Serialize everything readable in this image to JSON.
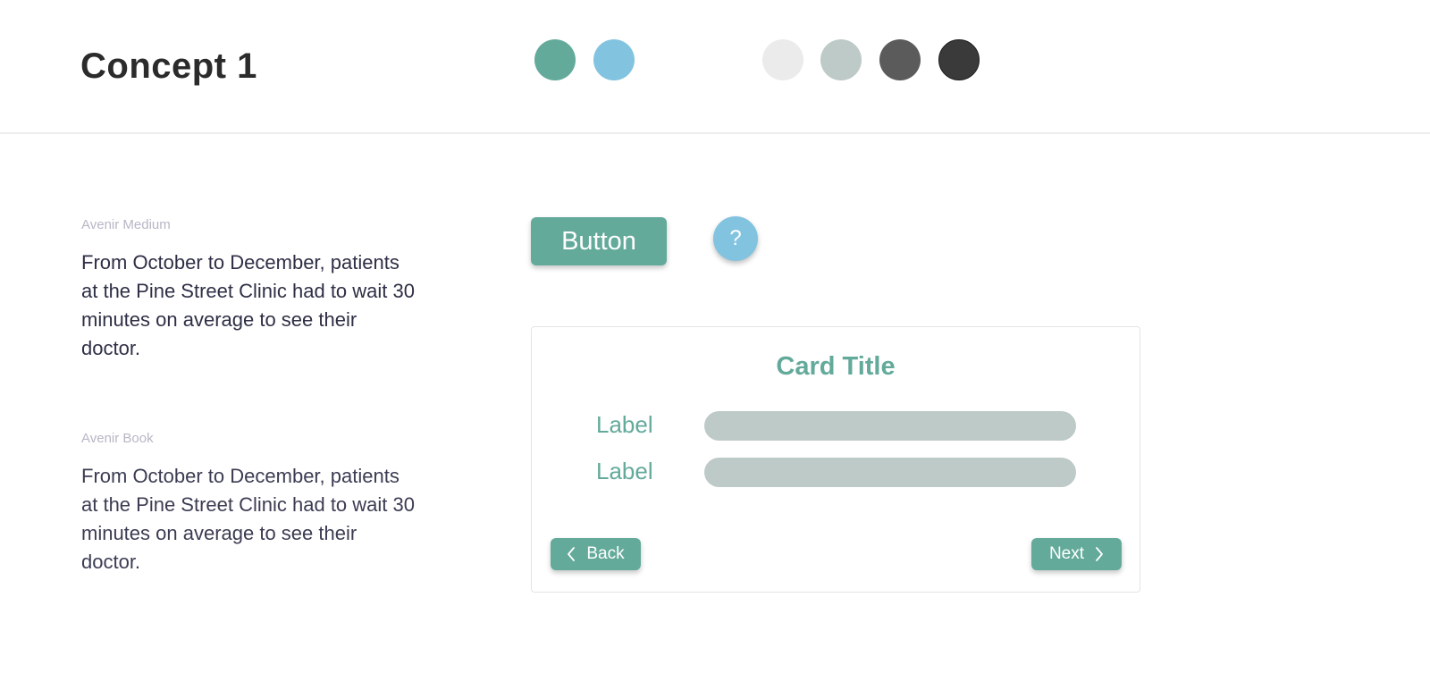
{
  "header": {
    "title": "Concept 1",
    "palette": [
      {
        "name": "teal",
        "color": "#63aa9b"
      },
      {
        "name": "sky-blue",
        "color": "#82c3e0"
      },
      {
        "name": "light-gray",
        "color": "#ebebeb"
      },
      {
        "name": "sage-gray",
        "color": "#bdcac7"
      },
      {
        "name": "dark-gray",
        "color": "#5b5b5b"
      },
      {
        "name": "charcoal",
        "color": "#3a3a3a"
      }
    ]
  },
  "typography": {
    "medium": {
      "label": "Avenir Medium",
      "sample": "From October to December, patients at the Pine Street Clinic had to wait 30 minutes on average to see their doctor."
    },
    "book": {
      "label": "Avenir Book",
      "sample": "From October to December, patients at the Pine Street Clinic had to wait 30 minutes on average to see their doctor."
    }
  },
  "components": {
    "button_label": "Button",
    "help_label": "?",
    "card": {
      "title": "Card Title",
      "fields": [
        {
          "label": "Label"
        },
        {
          "label": "Label"
        }
      ],
      "back_label": "Back",
      "next_label": "Next",
      "back_icon": "chevron-left-icon",
      "next_icon": "chevron-right-icon"
    }
  },
  "colors": {
    "accent": "#63aa9b",
    "secondary": "#82c3e0",
    "text": "#2e2f45",
    "muted": "#b7b7c6"
  }
}
